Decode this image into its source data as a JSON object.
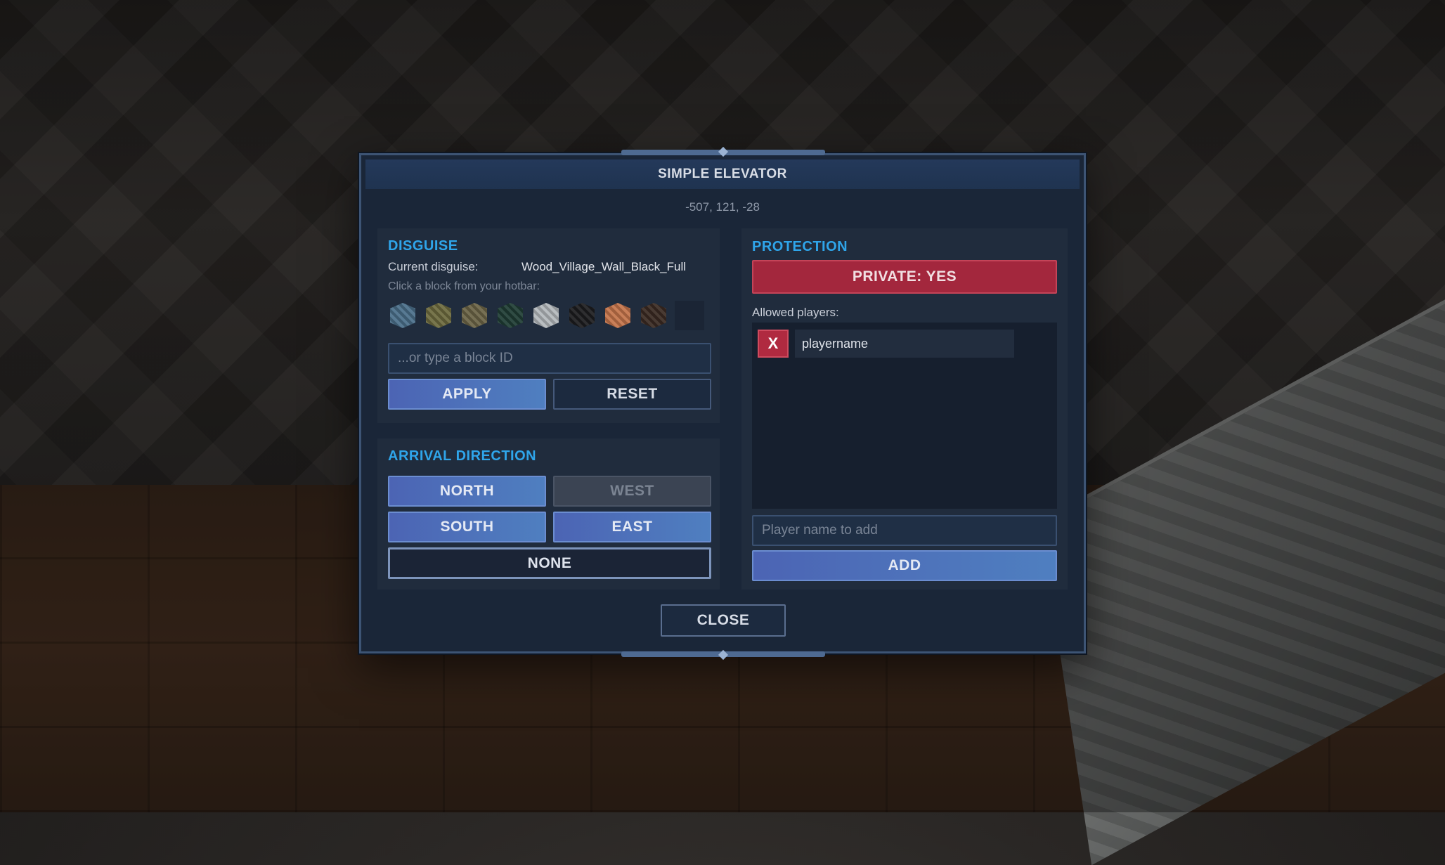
{
  "dialog": {
    "title": "SIMPLE ELEVATOR",
    "coordinates": "-507, 121, -28",
    "close_label": "CLOSE"
  },
  "disguise": {
    "section_title": "DISGUISE",
    "current_label": "Current disguise:",
    "current_value": "Wood_Village_Wall_Black_Full",
    "hotbar_hint": "Click a block from your hotbar:",
    "hotbar": [
      {
        "name": "ornate-blue-stone-block-icon",
        "color": "#4a6f8a"
      },
      {
        "name": "mossy-stone-block-icon",
        "color": "#6d6a3e"
      },
      {
        "name": "stone-brick-block-icon",
        "color": "#6b6446"
      },
      {
        "name": "dark-green-block-icon",
        "color": "#1f3d34"
      },
      {
        "name": "light-stone-block-icon",
        "color": "#b3b8bc"
      },
      {
        "name": "black-stone-block-icon",
        "color": "#1c1c1e"
      },
      {
        "name": "terracotta-block-icon",
        "color": "#c4744a"
      },
      {
        "name": "dark-wood-block-icon",
        "color": "#3a2a22"
      },
      {
        "name": "empty-slot",
        "color": ""
      }
    ],
    "block_id_placeholder": "...or type a block ID",
    "apply_label": "APPLY",
    "reset_label": "RESET"
  },
  "arrival": {
    "section_title": "ARRIVAL DIRECTION",
    "north": "NORTH",
    "west": "WEST",
    "south": "SOUTH",
    "east": "EAST",
    "none": "NONE"
  },
  "protection": {
    "section_title": "PROTECTION",
    "private_label": "PRIVATE: YES",
    "allowed_label": "Allowed players:",
    "players": [
      {
        "remove_label": "X",
        "name": "playername"
      }
    ],
    "add_placeholder": "Player name to add",
    "add_label": "ADD"
  },
  "colors": {
    "accent": "#2fa5ea",
    "private_red": "#a3273d",
    "button_blue": "#4f7fc0"
  }
}
